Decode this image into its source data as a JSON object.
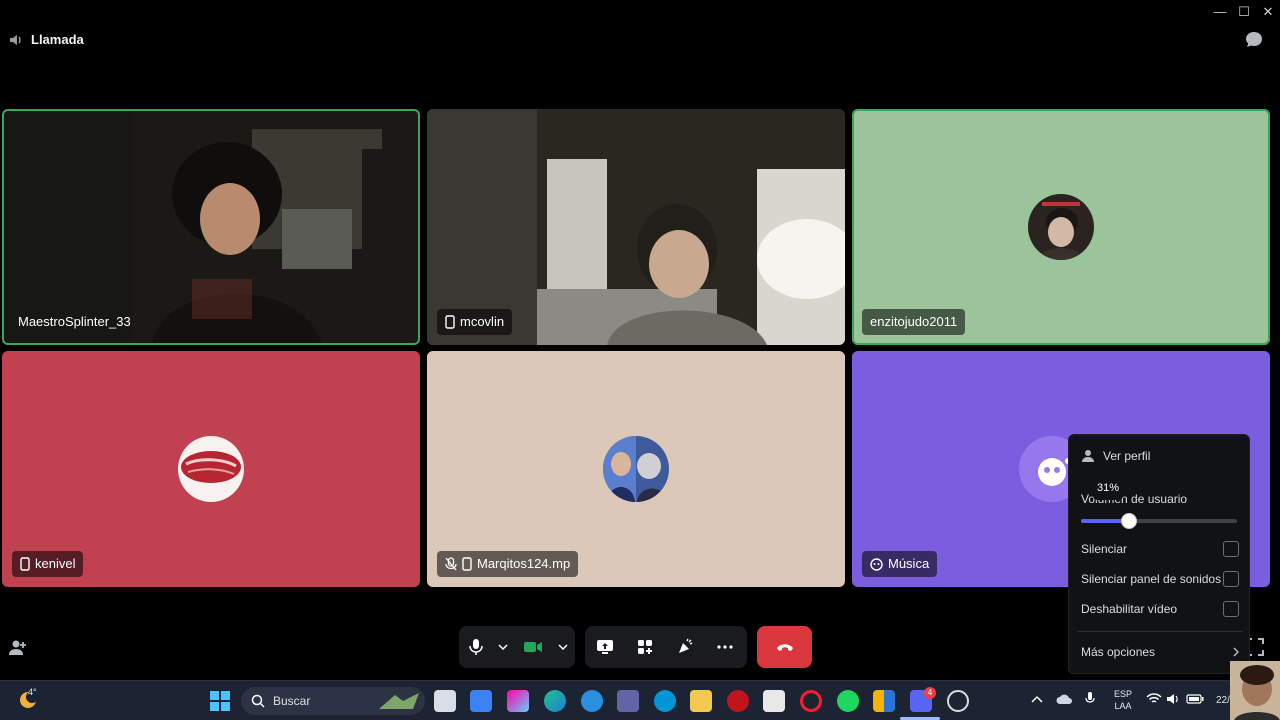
{
  "window": {
    "minimize": "—",
    "maximize": "☐",
    "close": "✕"
  },
  "header": {
    "title": "Llamada"
  },
  "tiles": [
    {
      "name": "MaestroSplinter_33",
      "bg": "#1e1a16",
      "speaking": true,
      "device": ""
    },
    {
      "name": "mcovlin",
      "bg": "#2a2620",
      "speaking": false,
      "device": "mobile"
    },
    {
      "name": "enzitojudo2011",
      "bg": "#9bc49b",
      "speaking": true,
      "device": ""
    },
    {
      "name": "kenivel",
      "bg": "#c24150",
      "speaking": false,
      "device": "mobile"
    },
    {
      "name": "Marqitos124.mp",
      "bg": "#dcc8b8",
      "speaking": false,
      "device": "mobile-muted"
    },
    {
      "name": "Música",
      "bg": "#7b5ee0",
      "speaking": false,
      "device": "bot"
    }
  ],
  "menu": {
    "view_profile": "Ver perfil",
    "volume_label": "Volumen de usuario",
    "volume_value": "31%",
    "volume_fraction": 0.31,
    "mute": "Silenciar",
    "mute_soundboard": "Silenciar panel de sonidos",
    "disable_video": "Deshabilitar vídeo",
    "more_options": "Más opciones"
  },
  "taskbar": {
    "weather_temp": "4°",
    "search_label": "Buscar",
    "lang_top": "ESP",
    "lang_bottom": "LAA",
    "date_partial": "22/",
    "discord_badge": "4"
  },
  "colors": {
    "accent": "#5865f2",
    "speaking": "#3ba55c",
    "end_call": "#da373c"
  }
}
